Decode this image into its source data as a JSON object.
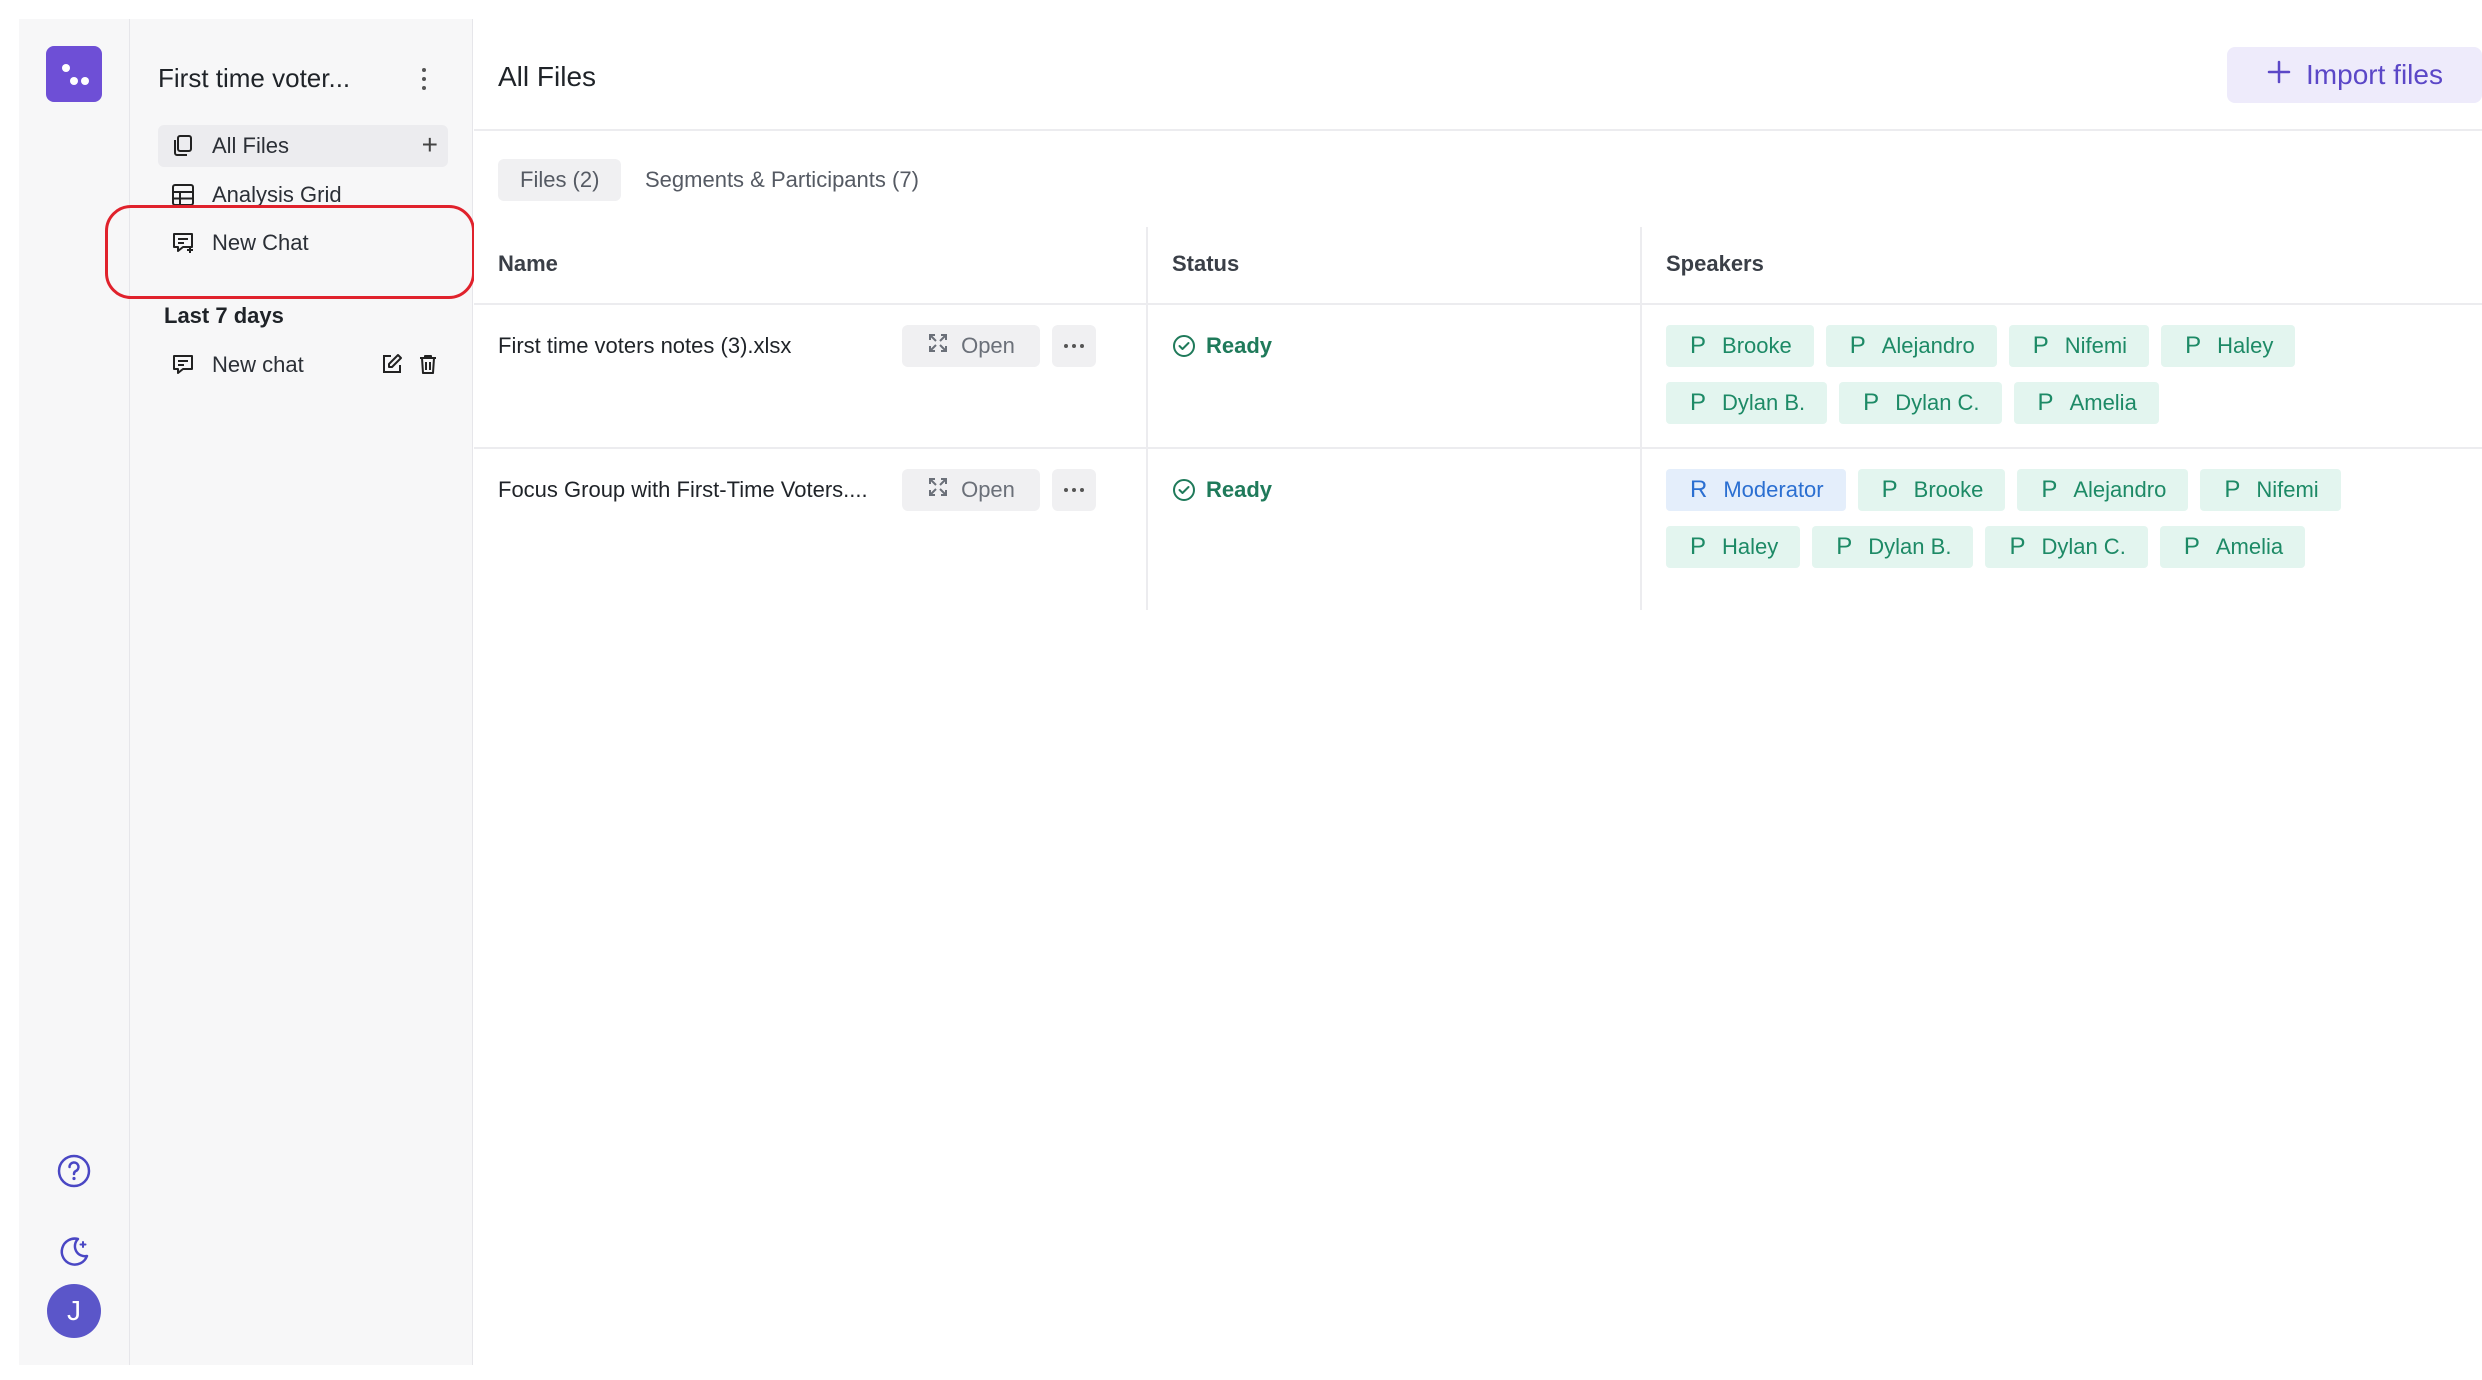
{
  "rail": {
    "logo": "app-logo",
    "help_icon": "help-circle-icon",
    "theme_icon": "moon-sun-icon",
    "avatar_initial": "J"
  },
  "sidebar": {
    "project_title": "First time voter...",
    "items": [
      {
        "label": "All Files",
        "icon": "files-icon"
      },
      {
        "label": "Analysis Grid",
        "icon": "grid-icon"
      },
      {
        "label": "New Chat",
        "icon": "chat-plus-icon"
      }
    ],
    "section_heading": "Last 7 days",
    "recent_chats": [
      {
        "label": "New chat",
        "icon": "chat-icon"
      }
    ]
  },
  "main": {
    "title": "All Files",
    "import_label": "Import files",
    "tabs": [
      {
        "label": "Files (2)"
      },
      {
        "label": "Segments & Participants (7)"
      }
    ],
    "columns": {
      "name": "Name",
      "status": "Status",
      "speakers": "Speakers"
    },
    "open_label": "Open",
    "rows": [
      {
        "name": "First time voters notes (3).xlsx",
        "status": "Ready",
        "speakers": [
          {
            "prefix": "P",
            "name": "Brooke"
          },
          {
            "prefix": "P",
            "name": "Alejandro"
          },
          {
            "prefix": "P",
            "name": "Nifemi"
          },
          {
            "prefix": "P",
            "name": "Haley"
          },
          {
            "prefix": "P",
            "name": "Dylan B."
          },
          {
            "prefix": "P",
            "name": "Dylan C."
          },
          {
            "prefix": "P",
            "name": "Amelia"
          }
        ]
      },
      {
        "name": "Focus Group with First-Time Voters....",
        "status": "Ready",
        "speakers": [
          {
            "prefix": "R",
            "name": "Moderator"
          },
          {
            "prefix": "P",
            "name": "Brooke"
          },
          {
            "prefix": "P",
            "name": "Alejandro"
          },
          {
            "prefix": "P",
            "name": "Nifemi"
          },
          {
            "prefix": "P",
            "name": "Haley"
          },
          {
            "prefix": "P",
            "name": "Dylan B."
          },
          {
            "prefix": "P",
            "name": "Dylan C."
          },
          {
            "prefix": "P",
            "name": "Amelia"
          }
        ]
      }
    ]
  },
  "colors": {
    "accent": "#6e4fd6",
    "ready": "#1f7a5a",
    "chip_bg": "#e3f5ef",
    "chip_role_bg": "#e4eefb",
    "annotation": "#e0222c"
  }
}
